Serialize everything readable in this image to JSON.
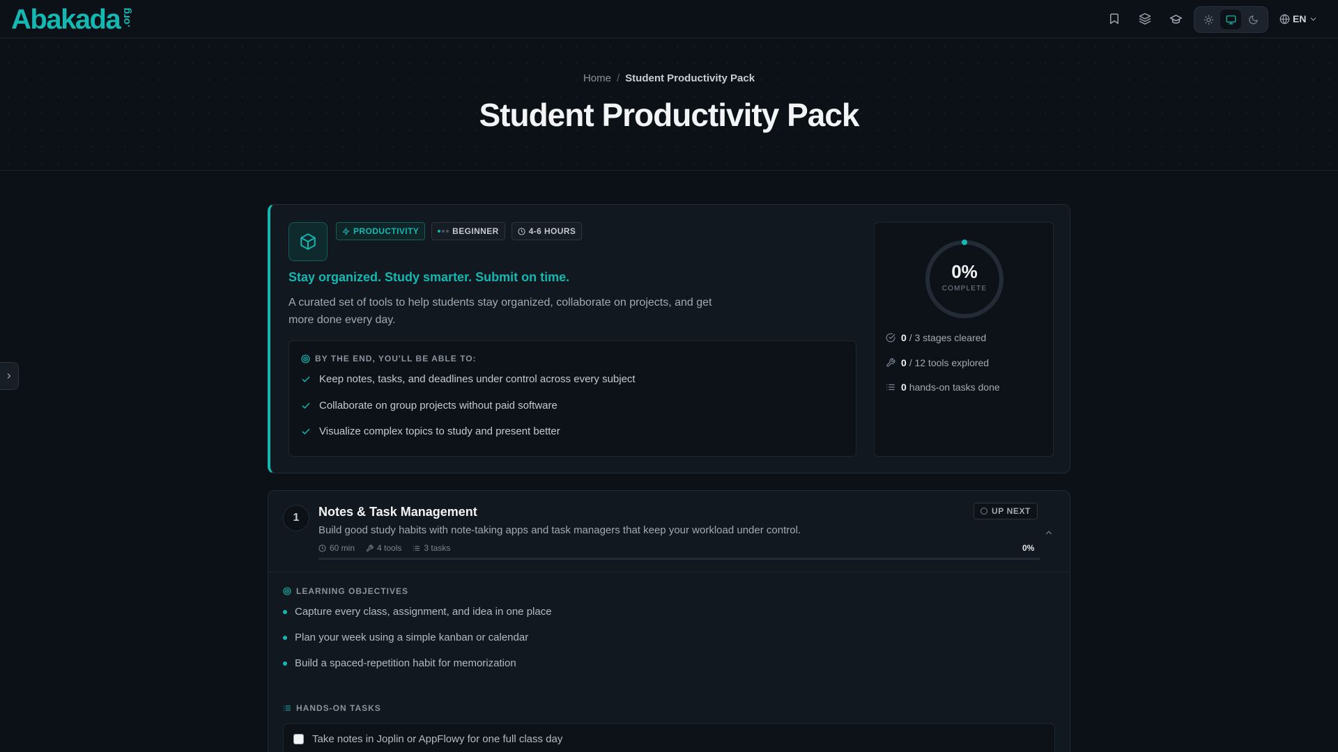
{
  "brand": {
    "name": "Abakada",
    "tld": ".org"
  },
  "header": {
    "icons": [
      "bookmark-icon",
      "layers-icon",
      "graduation-cap-icon"
    ],
    "theme": {
      "options": [
        "light",
        "system",
        "dark"
      ],
      "active": "system"
    },
    "language": "EN"
  },
  "breadcrumb": {
    "home": "Home",
    "separator": "/",
    "current": "Student Productivity Pack"
  },
  "page": {
    "title": "Student Productivity Pack"
  },
  "overview": {
    "badges": {
      "category": "PRODUCTIVITY",
      "level": "BEGINNER",
      "duration": "4-6 HOURS"
    },
    "tagline": "Stay organized. Study smarter. Submit on time.",
    "description": "A curated set of tools to help students stay organized, collaborate on projects, and get more done every day.",
    "outcomes_heading": "BY THE END, YOU'LL BE ABLE TO:",
    "outcomes": [
      "Keep notes, tasks, and deadlines under control across every subject",
      "Collaborate on group projects without paid software",
      "Visualize complex topics to study and present better"
    ]
  },
  "progress": {
    "percent_label": "0%",
    "percent_value": 0,
    "caption": "COMPLETE",
    "stages": {
      "done": "0",
      "text": "/ 3 stages cleared"
    },
    "tools": {
      "done": "0",
      "text": "/ 12 tools explored"
    },
    "tasks": {
      "done": "0",
      "text": "hands-on tasks done"
    }
  },
  "stage1": {
    "number": "1",
    "title": "Notes & Task Management",
    "description": "Build good study habits with note-taking apps and task managers that keep your workload under control.",
    "meta": {
      "time": "60 min",
      "tools": "4 tools",
      "tasks": "3 tasks"
    },
    "status": "UP NEXT",
    "percent": "0%",
    "objectives_heading": "LEARNING OBJECTIVES",
    "objectives": [
      "Capture every class, assignment, and idea in one place",
      "Plan your week using a simple kanban or calendar",
      "Build a spaced-repetition habit for memorization"
    ],
    "tasks_heading": "HANDS-ON TASKS",
    "tasks": [
      "Take notes in Joplin or AppFlowy for one full class day"
    ]
  },
  "colors": {
    "accent": "#14b8b0",
    "background": "#0b1117",
    "card": "#12181f"
  }
}
